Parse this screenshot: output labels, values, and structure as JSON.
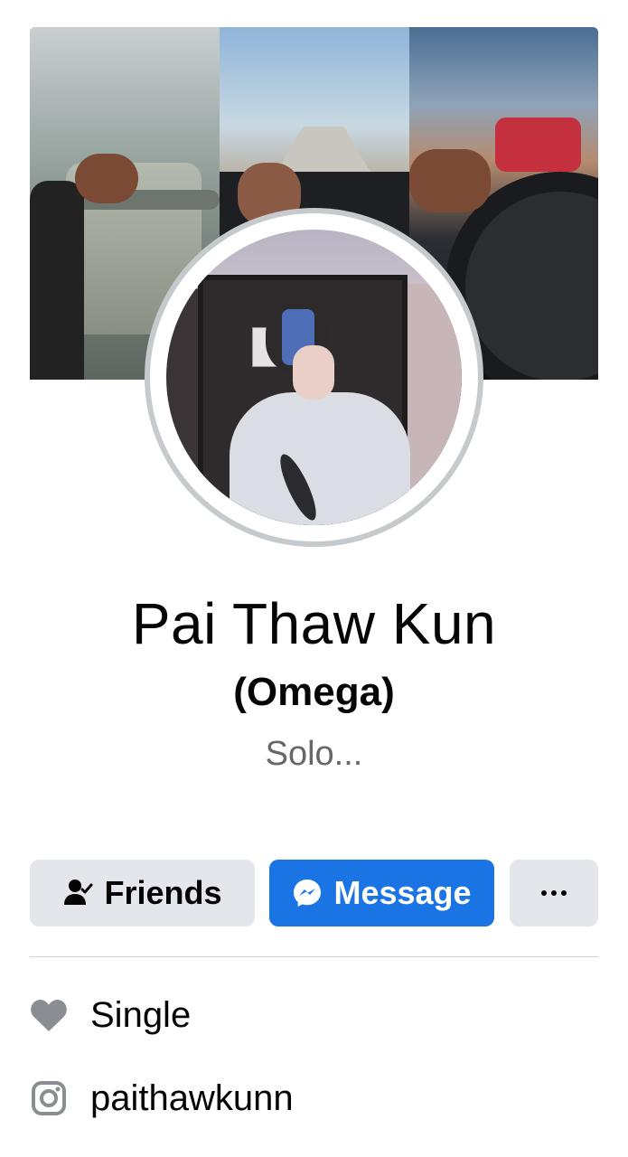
{
  "profile": {
    "name": "Pai Thaw Kun",
    "alternate_name": "(Omega)",
    "bio": "Solo..."
  },
  "actions": {
    "friends_label": "Friends",
    "message_label": "Message",
    "friends_icon": "person-check-icon",
    "message_icon": "messenger-icon",
    "more_icon": "more-dots-icon"
  },
  "details": {
    "relationship": {
      "icon": "heart-icon",
      "text": "Single"
    },
    "instagram": {
      "icon": "instagram-icon",
      "text": "paithawkunn"
    }
  },
  "colors": {
    "accent": "#1b74e4",
    "button_secondary": "#e4e6eb",
    "muted_text": "#65676b",
    "icon_gray": "#8a8d91"
  }
}
